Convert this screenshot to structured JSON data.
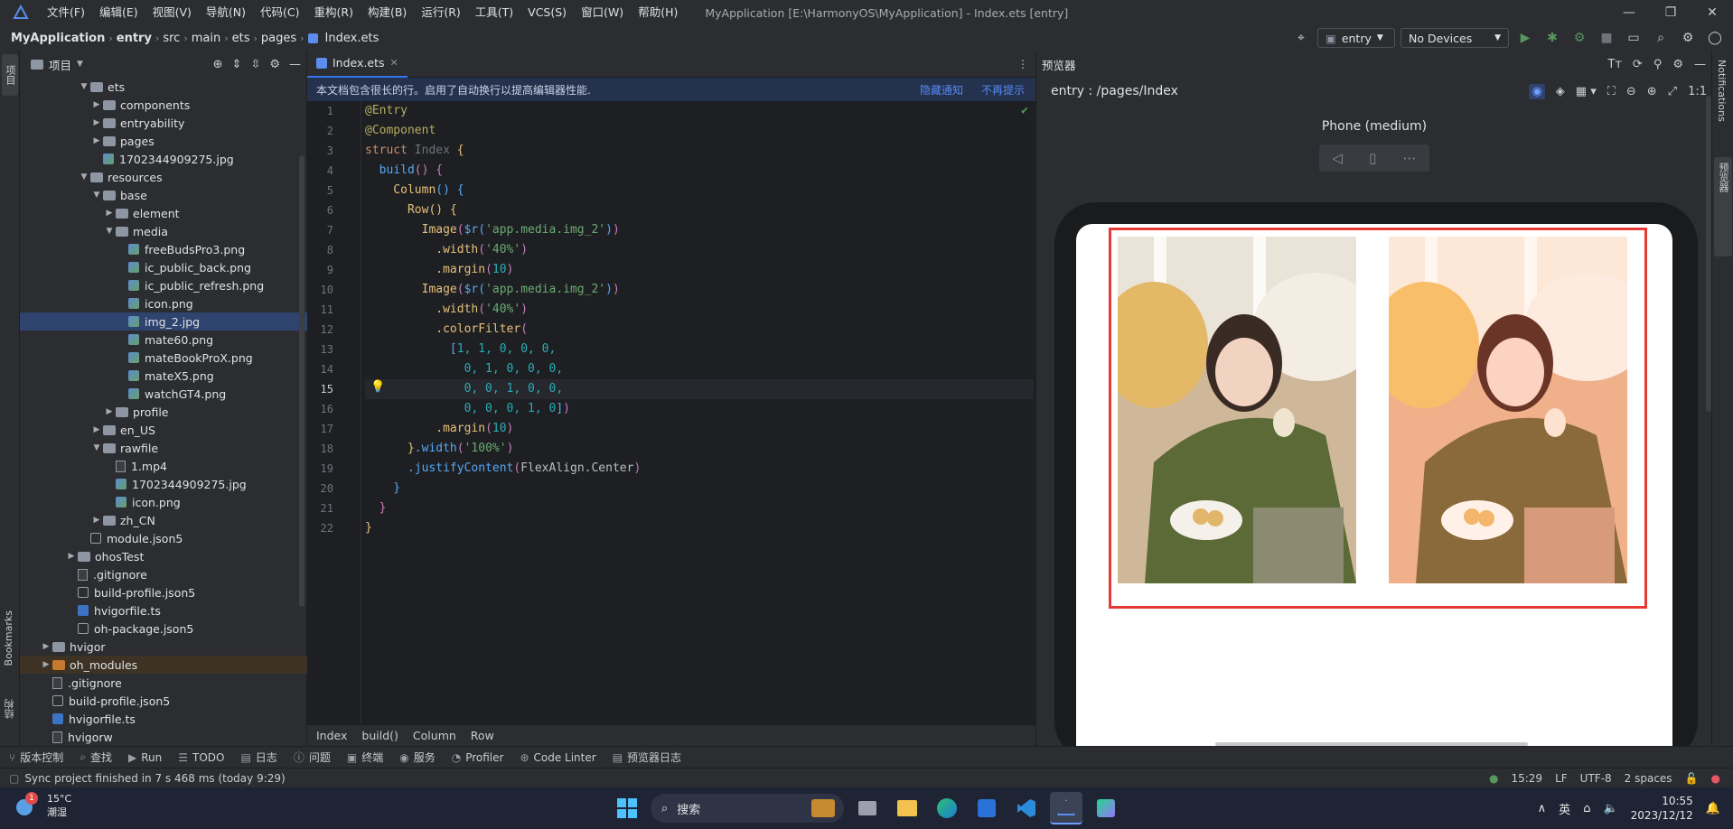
{
  "menubar": {
    "items": [
      "文件(F)",
      "编辑(E)",
      "视图(V)",
      "导航(N)",
      "代码(C)",
      "重构(R)",
      "构建(B)",
      "运行(R)",
      "工具(T)",
      "VCS(S)",
      "窗口(W)",
      "帮助(H)"
    ],
    "window_title": "MyApplication [E:\\HarmonyOS\\MyApplication] - Index.ets [entry]"
  },
  "navbar": {
    "crumbs": [
      "MyApplication",
      "entry",
      "src",
      "main",
      "ets",
      "pages",
      "Index.ets"
    ],
    "module_select": "entry",
    "device_select": "No Devices"
  },
  "left_stripe": {
    "project_label": "项目",
    "bookmarks_label": "Bookmarks",
    "structure_label": "结构"
  },
  "project_panel": {
    "title": "项目",
    "tree": [
      {
        "label": "ets",
        "type": "folder",
        "depth": 4,
        "expanded": true
      },
      {
        "label": "components",
        "type": "folder",
        "depth": 5,
        "expanded": false
      },
      {
        "label": "entryability",
        "type": "folder",
        "depth": 5,
        "expanded": false
      },
      {
        "label": "pages",
        "type": "folder",
        "depth": 5,
        "expanded": false
      },
      {
        "label": "1702344909275.jpg",
        "type": "image",
        "depth": 5
      },
      {
        "label": "resources",
        "type": "folder",
        "depth": 4,
        "expanded": true
      },
      {
        "label": "base",
        "type": "folder",
        "depth": 5,
        "expanded": true
      },
      {
        "label": "element",
        "type": "folder",
        "depth": 6,
        "expanded": false
      },
      {
        "label": "media",
        "type": "folder",
        "depth": 6,
        "expanded": true
      },
      {
        "label": "freeBudsPro3.png",
        "type": "image",
        "depth": 7
      },
      {
        "label": "ic_public_back.png",
        "type": "image",
        "depth": 7
      },
      {
        "label": "ic_public_refresh.png",
        "type": "image",
        "depth": 7
      },
      {
        "label": "icon.png",
        "type": "image",
        "depth": 7
      },
      {
        "label": "img_2.jpg",
        "type": "image",
        "depth": 7,
        "selected": true
      },
      {
        "label": "mate60.png",
        "type": "image",
        "depth": 7
      },
      {
        "label": "mateBookProX.png",
        "type": "image",
        "depth": 7
      },
      {
        "label": "mateX5.png",
        "type": "image",
        "depth": 7
      },
      {
        "label": "watchGT4.png",
        "type": "image",
        "depth": 7
      },
      {
        "label": "profile",
        "type": "folder",
        "depth": 6,
        "expanded": false
      },
      {
        "label": "en_US",
        "type": "folder",
        "depth": 5,
        "expanded": false
      },
      {
        "label": "rawfile",
        "type": "folder",
        "depth": 5,
        "expanded": true
      },
      {
        "label": "1.mp4",
        "type": "file",
        "depth": 6
      },
      {
        "label": "1702344909275.jpg",
        "type": "image",
        "depth": 6
      },
      {
        "label": "icon.png",
        "type": "image",
        "depth": 6
      },
      {
        "label": "zh_CN",
        "type": "folder",
        "depth": 5,
        "expanded": false
      },
      {
        "label": "module.json5",
        "type": "json",
        "depth": 4
      },
      {
        "label": "ohosTest",
        "type": "folder",
        "depth": 3,
        "expanded": false
      },
      {
        "label": ".gitignore",
        "type": "file",
        "depth": 3
      },
      {
        "label": "build-profile.json5",
        "type": "json",
        "depth": 3
      },
      {
        "label": "hvigorfile.ts",
        "type": "ts",
        "depth": 3
      },
      {
        "label": "oh-package.json5",
        "type": "json",
        "depth": 3
      },
      {
        "label": "hvigor",
        "type": "folder",
        "depth": 1,
        "expanded": false
      },
      {
        "label": "oh_modules",
        "type": "folder-orange",
        "depth": 1,
        "expanded": false,
        "highlight": true
      },
      {
        "label": ".gitignore",
        "type": "file",
        "depth": 1
      },
      {
        "label": "build-profile.json5",
        "type": "json",
        "depth": 1
      },
      {
        "label": "hvigorfile.ts",
        "type": "ts",
        "depth": 1
      },
      {
        "label": "hvigorw",
        "type": "file",
        "depth": 1
      }
    ]
  },
  "editor": {
    "tab": "Index.ets",
    "notice": "本文档包含很长的行。启用了自动换行以提高编辑器性能.",
    "notice_link_hide": "隐藏通知",
    "notice_link_never": "不再提示",
    "current_line": 15,
    "lines": [
      [
        {
          "t": "@Entry",
          "c": "kw-ann"
        }
      ],
      [
        {
          "t": "@Component",
          "c": "kw-ann"
        }
      ],
      [
        {
          "t": "struct ",
          "c": "kw"
        },
        {
          "t": "Index ",
          "c": "cls"
        },
        {
          "t": "{",
          "c": "b1"
        }
      ],
      [
        {
          "t": "  build",
          "c": "fn"
        },
        {
          "t": "() ",
          "c": "b2"
        },
        {
          "t": "{",
          "c": "b2"
        }
      ],
      [
        {
          "t": "    Column",
          "c": "b1"
        },
        {
          "t": "() ",
          "c": "b3"
        },
        {
          "t": "{",
          "c": "b3"
        }
      ],
      [
        {
          "t": "      Row",
          "c": "b1"
        },
        {
          "t": "() ",
          "c": "b1"
        },
        {
          "t": "{",
          "c": "b1"
        }
      ],
      [
        {
          "t": "        Image",
          "c": "b1"
        },
        {
          "t": "(",
          "c": "b2"
        },
        {
          "t": "$r",
          "c": "fn"
        },
        {
          "t": "(",
          "c": "b3"
        },
        {
          "t": "'app.media.img_2'",
          "c": "str"
        },
        {
          "t": ")",
          "c": "b3"
        },
        {
          "t": ")",
          "c": "b2"
        }
      ],
      [
        {
          "t": "          .width",
          "c": "b1"
        },
        {
          "t": "(",
          "c": "b2"
        },
        {
          "t": "'40%'",
          "c": "str"
        },
        {
          "t": ")",
          "c": "b2"
        }
      ],
      [
        {
          "t": "          .margin",
          "c": "b1"
        },
        {
          "t": "(",
          "c": "b2"
        },
        {
          "t": "10",
          "c": "num"
        },
        {
          "t": ")",
          "c": "b2"
        }
      ],
      [
        {
          "t": "        Image",
          "c": "b1"
        },
        {
          "t": "(",
          "c": "b2"
        },
        {
          "t": "$r",
          "c": "fn"
        },
        {
          "t": "(",
          "c": "b3"
        },
        {
          "t": "'app.media.img_2'",
          "c": "str"
        },
        {
          "t": ")",
          "c": "b3"
        },
        {
          "t": ")",
          "c": "b2"
        }
      ],
      [
        {
          "t": "          .width",
          "c": "b1"
        },
        {
          "t": "(",
          "c": "b2"
        },
        {
          "t": "'40%'",
          "c": "str"
        },
        {
          "t": ")",
          "c": "b2"
        }
      ],
      [
        {
          "t": "          .colorFilter",
          "c": "b1"
        },
        {
          "t": "(",
          "c": "b2"
        }
      ],
      [
        {
          "t": "            [",
          "c": "b3"
        },
        {
          "t": "1, 1, 0, 0, 0,",
          "c": "num"
        }
      ],
      [
        {
          "t": "              0, 1, 0, 0, 0,",
          "c": "num"
        }
      ],
      [
        {
          "t": "              0, 0, 1, 0, 0,",
          "c": "num"
        }
      ],
      [
        {
          "t": "              0, 0, 0, 1, 0",
          "c": "num"
        },
        {
          "t": "]",
          "c": "b3"
        },
        {
          "t": ")",
          "c": "b2"
        }
      ],
      [
        {
          "t": "          .margin",
          "c": "b1"
        },
        {
          "t": "(",
          "c": "b2"
        },
        {
          "t": "10",
          "c": "num"
        },
        {
          "t": ")",
          "c": "b2"
        }
      ],
      [
        {
          "t": "      }",
          "c": "b1"
        },
        {
          "t": ".width",
          "c": "fn"
        },
        {
          "t": "(",
          "c": "b2"
        },
        {
          "t": "'100%'",
          "c": "str"
        },
        {
          "t": ")",
          "c": "b2"
        }
      ],
      [
        {
          "t": "      .justifyContent",
          "c": "fn"
        },
        {
          "t": "(",
          "c": "b2"
        },
        {
          "t": "FlexAlign.Center",
          "c": "cls2"
        },
        {
          "t": ")",
          "c": "b2"
        }
      ],
      [
        {
          "t": "    }",
          "c": "b3"
        }
      ],
      [
        {
          "t": "  }",
          "c": "b2"
        }
      ],
      [
        {
          "t": "}",
          "c": "b1"
        }
      ]
    ],
    "breadcrumbs": [
      "Index",
      "build()",
      "Column",
      "Row"
    ]
  },
  "preview": {
    "title": "预览器",
    "path": "entry : /pages/Index",
    "ratio_label": "1:1",
    "device_name": "Phone (medium)"
  },
  "right_stripe": {
    "notifications": "Notifications",
    "previewer": "预览器"
  },
  "tool_window_bar": [
    "版本控制",
    "查找",
    "Run",
    "TODO",
    "日志",
    "问题",
    "终端",
    "服务",
    "Profiler",
    "Code Linter",
    "预览器日志"
  ],
  "status_bar": {
    "message": "Sync project finished in 7 s 468 ms (today 9:29)",
    "position": "15:29",
    "line_sep": "LF",
    "encoding": "UTF-8",
    "indent": "2 spaces"
  },
  "taskbar": {
    "weather_temp": "15°C",
    "weather_desc": "潮湿",
    "weather_badge": "1",
    "search_placeholder": "搜索",
    "ime": "英",
    "time": "10:55",
    "date": "2023/12/12"
  },
  "colors": {
    "accent": "#3574f0",
    "selection": "#2e436e",
    "red_box": "#e53935"
  }
}
